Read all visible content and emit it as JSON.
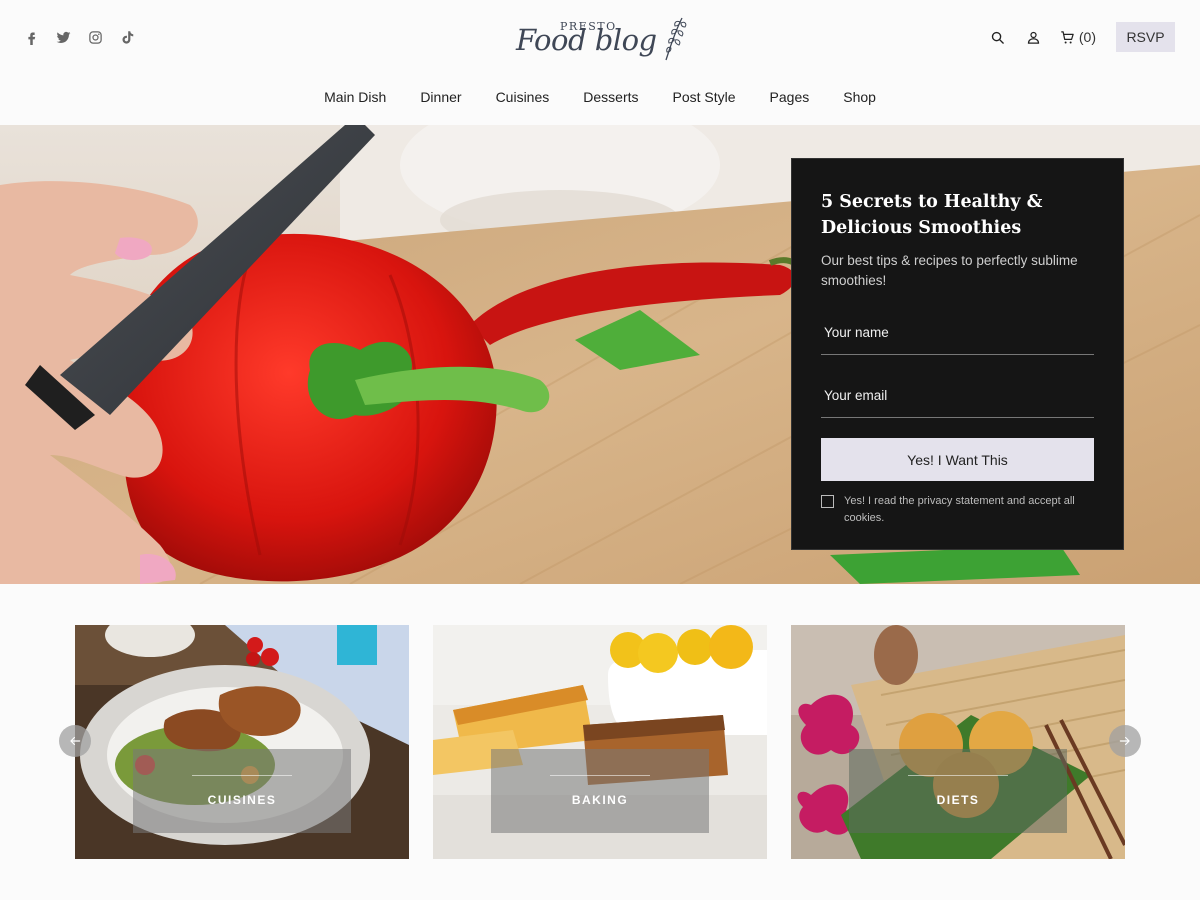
{
  "header": {
    "social": [
      {
        "icon": "facebook-icon"
      },
      {
        "icon": "twitter-icon"
      },
      {
        "icon": "instagram-icon"
      },
      {
        "icon": "tiktok-icon"
      }
    ],
    "logo": {
      "small": "PRESTO",
      "script": "Food blog"
    },
    "actions": {
      "search_icon": "search-icon",
      "account_icon": "user-icon",
      "cart_icon": "cart-icon",
      "cart_count": "(0)"
    },
    "rsvp_label": "RSVP"
  },
  "nav": {
    "items": [
      {
        "label": "Main Dish"
      },
      {
        "label": "Dinner"
      },
      {
        "label": "Cuisines"
      },
      {
        "label": "Desserts"
      },
      {
        "label": "Post Style"
      },
      {
        "label": "Pages"
      },
      {
        "label": "Shop"
      }
    ]
  },
  "hero": {
    "optin": {
      "title": "5 Secrets to Healthy & Delicious Smoothies",
      "subtitle": "Our best tips & recipes to perfectly sublime smoothies!",
      "name_placeholder": "Your name",
      "email_placeholder": "Your email",
      "button_label": "Yes! I Want This",
      "consent_text": "Yes! I read the privacy statement and accept all cookies."
    }
  },
  "categories": {
    "cards": [
      {
        "label": "CUISINES"
      },
      {
        "label": "BAKING"
      },
      {
        "label": "DIETS"
      }
    ],
    "prev_icon": "arrow-left-icon",
    "next_icon": "arrow-right-icon"
  },
  "colors": {
    "accent_button": "#e4e2ec",
    "optin_bg": "#151515",
    "logo": "#3f4756"
  }
}
